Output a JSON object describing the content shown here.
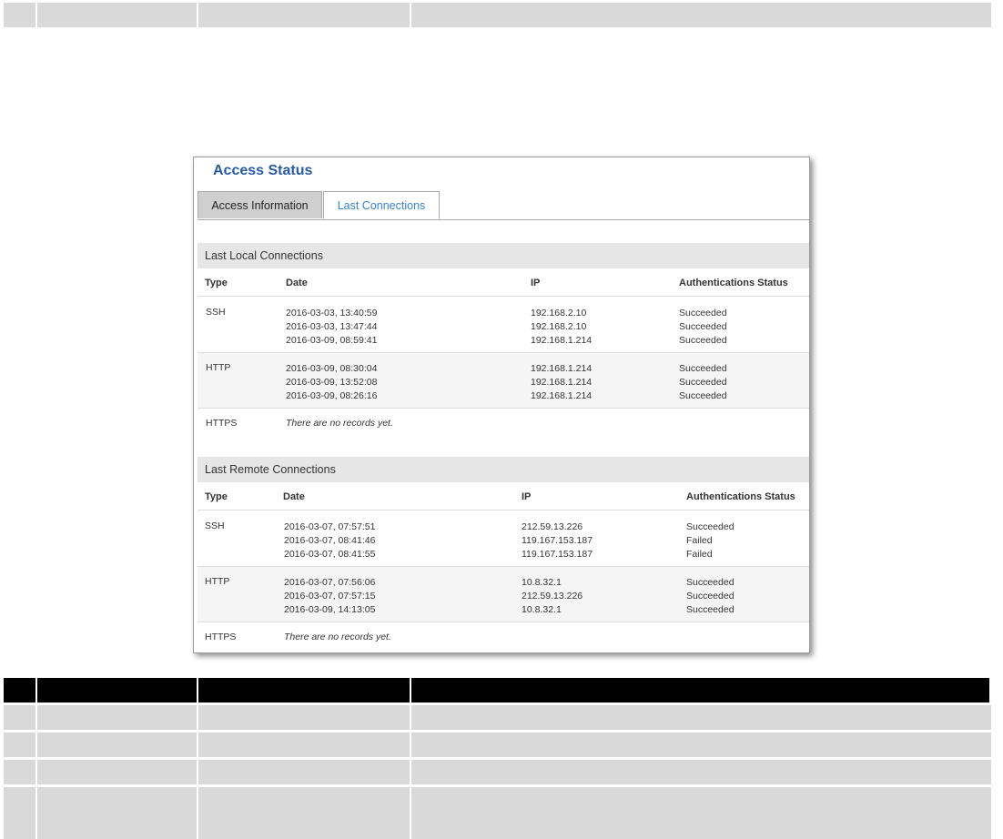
{
  "panel": {
    "title": "Access Status",
    "tabs": [
      {
        "label": "Access Information",
        "active": false
      },
      {
        "label": "Last Connections",
        "active": true
      }
    ]
  },
  "columns": {
    "type": "Type",
    "date": "Date",
    "ip": "IP",
    "status": "Authentications Status"
  },
  "local": {
    "title": "Last Local Connections",
    "groups": [
      {
        "type": "SSH",
        "dates": [
          "2016-03-03, 13:40:59",
          "2016-03-03, 13:47:44",
          "2016-03-09, 08:59:41"
        ],
        "ips": [
          "192.168.2.10",
          "192.168.2.10",
          "192.168.1.214"
        ],
        "statuses": [
          "Succeeded",
          "Succeeded",
          "Succeeded"
        ]
      },
      {
        "type": "HTTP",
        "dates": [
          "2016-03-09, 08:30:04",
          "2016-03-09, 13:52:08",
          "2016-03-09, 08:26:16"
        ],
        "ips": [
          "192.168.1.214",
          "192.168.1.214",
          "192.168.1.214"
        ],
        "statuses": [
          "Succeeded",
          "Succeeded",
          "Succeeded"
        ]
      },
      {
        "type": "HTTPS",
        "empty": "There are no records yet."
      }
    ]
  },
  "remote": {
    "title": "Last Remote Connections",
    "groups": [
      {
        "type": "SSH",
        "dates": [
          "2016-03-07, 07:57:51",
          "2016-03-07, 08:41:46",
          "2016-03-07, 08:41:55"
        ],
        "ips": [
          "212.59.13.226",
          "119.167.153.187",
          "119.167.153.187"
        ],
        "statuses": [
          "Succeeded",
          "Failed",
          "Failed"
        ]
      },
      {
        "type": "HTTP",
        "dates": [
          "2016-03-07, 07:56:06",
          "2016-03-07, 07:57:15",
          "2016-03-09, 14:13:05"
        ],
        "ips": [
          "10.8.32.1",
          "212.59.13.226",
          "10.8.32.1"
        ],
        "statuses": [
          "Succeeded",
          "Succeeded",
          "Succeeded"
        ]
      },
      {
        "type": "HTTPS",
        "empty": "There are no records yet."
      }
    ]
  },
  "colors": {
    "title": "#2a5aa0",
    "active_tab": "#3a82c4"
  }
}
